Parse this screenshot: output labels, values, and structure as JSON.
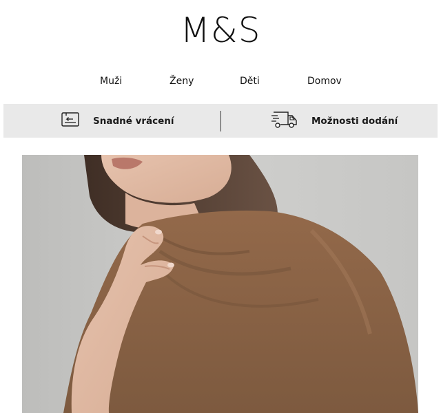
{
  "brand": {
    "logo_text": "M&S"
  },
  "nav": {
    "items": [
      {
        "label": "Muži"
      },
      {
        "label": "Ženy"
      },
      {
        "label": "Děti"
      },
      {
        "label": "Domov"
      }
    ]
  },
  "benefits": {
    "returns": {
      "label": "Snadné vrácení",
      "icon": "return-card-icon"
    },
    "delivery": {
      "label": "Možnosti dodání",
      "icon": "delivery-truck-icon"
    }
  },
  "hero": {
    "image": "woman-in-brown-draped-top",
    "colors": {
      "background": "#c9c9c7",
      "garment": "#8a6446",
      "skin": "#e2bba6"
    }
  }
}
